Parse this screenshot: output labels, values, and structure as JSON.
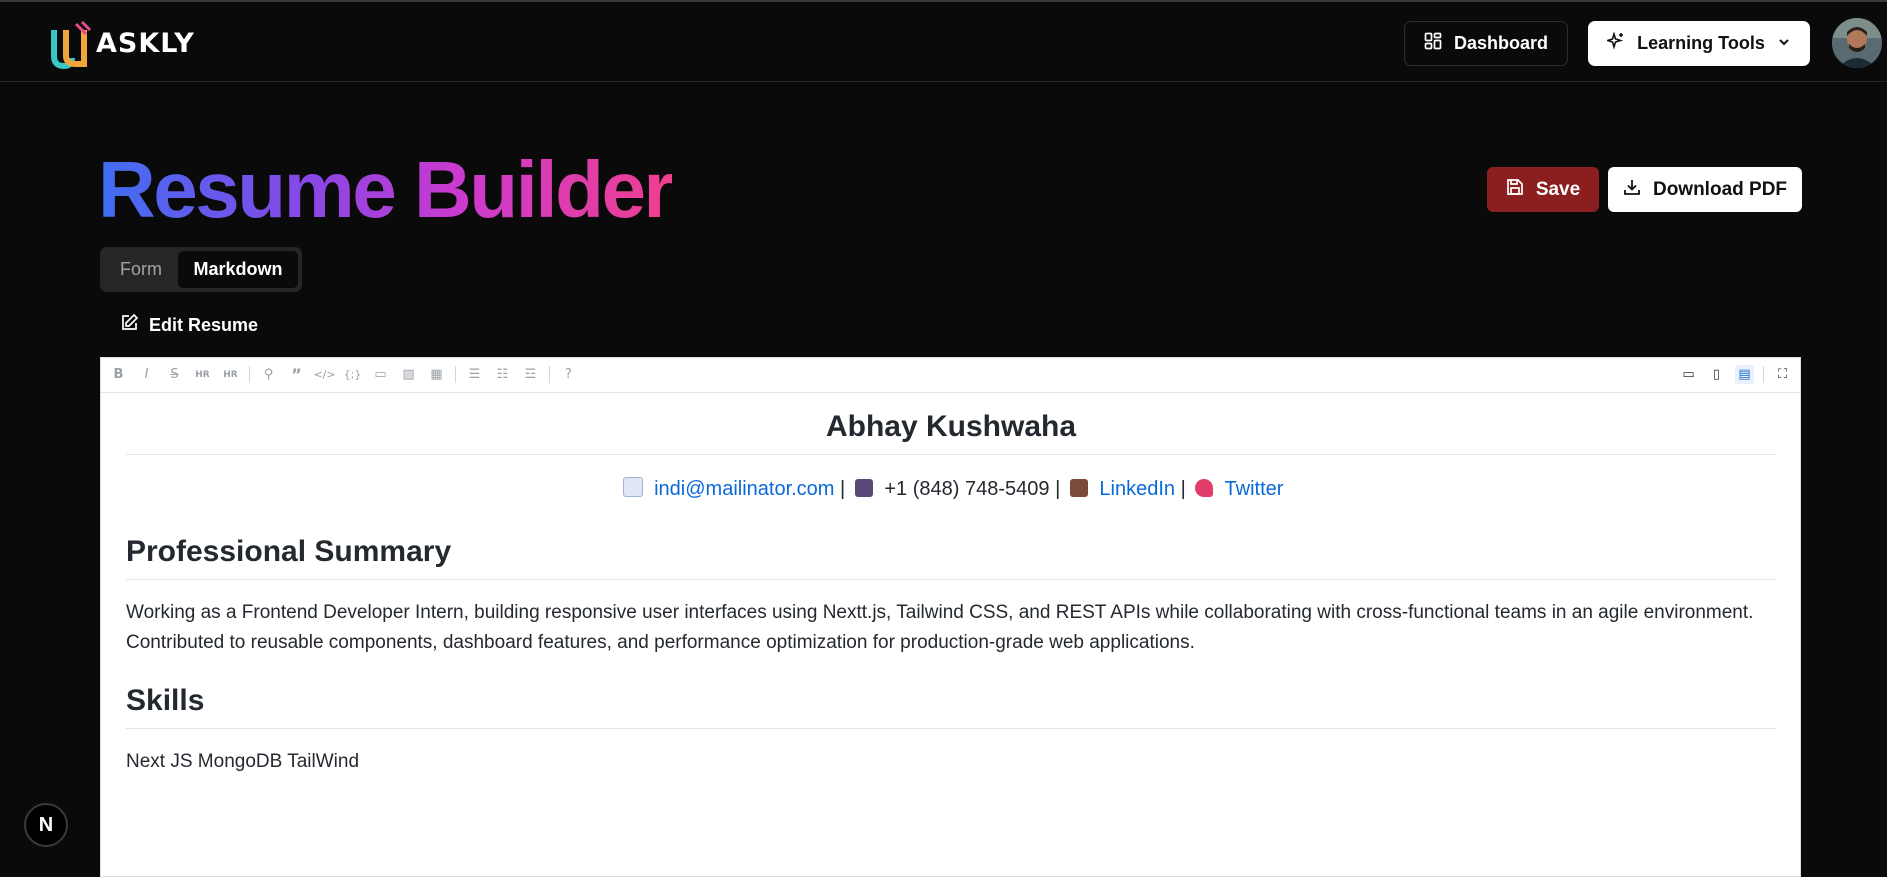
{
  "header": {
    "logo_text": "ASKLY",
    "dashboard_label": "Dashboard",
    "learning_tools_label": "Learning Tools"
  },
  "page": {
    "title": "Resume Builder",
    "save_label": "Save",
    "download_label": "Download PDF",
    "tabs": [
      {
        "label": "Form",
        "active": false
      },
      {
        "label": "Markdown",
        "active": true
      }
    ],
    "edit_label": "Edit Resume"
  },
  "editor": {
    "toolbar_left_icons": [
      "bold-icon",
      "italic-icon",
      "strikethrough-icon",
      "heading-icon",
      "heading-size-icon",
      "link-icon",
      "quote-icon",
      "code-icon",
      "code-block-icon",
      "comment-icon",
      "image-icon",
      "table-icon",
      "unordered-list-icon",
      "ordered-list-icon",
      "checklist-icon",
      "help-icon"
    ],
    "toolbar_right_icons": [
      "edit-mode-icon",
      "live-mode-icon",
      "preview-mode-icon",
      "fullscreen-icon"
    ],
    "preview": {
      "name": "Abhay Kushwaha",
      "contact": {
        "email": "indi@mailinator.com",
        "phone": "+1 (848) 748-5409",
        "linkedin": "LinkedIn",
        "twitter": "Twitter",
        "separator": "|"
      },
      "summary_heading": "Professional Summary",
      "summary_text": "Working as a Frontend Developer Intern, building responsive user interfaces using Nextt.js, Tailwind CSS, and REST APIs while collaborating with cross-functional teams in an agile environment. Contributed to reusable components, dashboard features, and performance optimization for production-grade web applications.",
      "skills_heading": "Skills",
      "skills_text": "Next JS MongoDB TailWind"
    }
  },
  "nextjs_badge": "N",
  "colors": {
    "background": "#0a0a0a",
    "save_button": "#8b1f1f",
    "link": "#0969da",
    "title_gradient": [
      "#3f6ef2",
      "#8b46e5",
      "#c93ad0",
      "#ef3f8f"
    ]
  }
}
